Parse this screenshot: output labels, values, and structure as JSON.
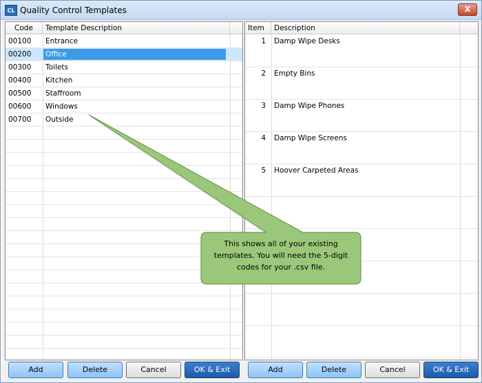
{
  "window": {
    "title": "Quality Control Templates",
    "icon_label": "CL",
    "close_label": "X"
  },
  "left_grid": {
    "headers": [
      "Code",
      "Template Description"
    ],
    "rows": [
      {
        "code": "00100",
        "description": "Entrance"
      },
      {
        "code": "00200",
        "description": "Office"
      },
      {
        "code": "00300",
        "description": "Toilets"
      },
      {
        "code": "00400",
        "description": "Kitchen"
      },
      {
        "code": "00500",
        "description": "Staffroom"
      },
      {
        "code": "00600",
        "description": "Windows"
      },
      {
        "code": "00700",
        "description": "Outside"
      }
    ],
    "selected_index": 1
  },
  "right_grid": {
    "headers": [
      "Item",
      "Description"
    ],
    "rows": [
      {
        "item": "1",
        "description": "Damp Wipe Desks"
      },
      {
        "item": "2",
        "description": "Empty Bins"
      },
      {
        "item": "3",
        "description": "Damp Wipe Phones"
      },
      {
        "item": "4",
        "description": "Damp Wipe Screens"
      },
      {
        "item": "5",
        "description": "Hoover Carpeted Areas"
      }
    ]
  },
  "left_buttons": {
    "add": "Add",
    "delete": "Delete",
    "cancel": "Cancel",
    "ok_exit": "OK & Exit"
  },
  "right_buttons": {
    "add": "Add",
    "delete": "Delete",
    "cancel": "Cancel",
    "ok_exit": "OK & Exit"
  },
  "callout": {
    "lines": [
      "This shows all of your existing",
      "templates.  You will need the 5-digit",
      "codes for your .csv file."
    ],
    "fill_color": "#9bc77a",
    "border_color": "#6f9a4e"
  },
  "colors": {
    "selection": "#3c9ae8",
    "title_bar": "#c4daf1",
    "primary_button": "#1e5aa8"
  }
}
